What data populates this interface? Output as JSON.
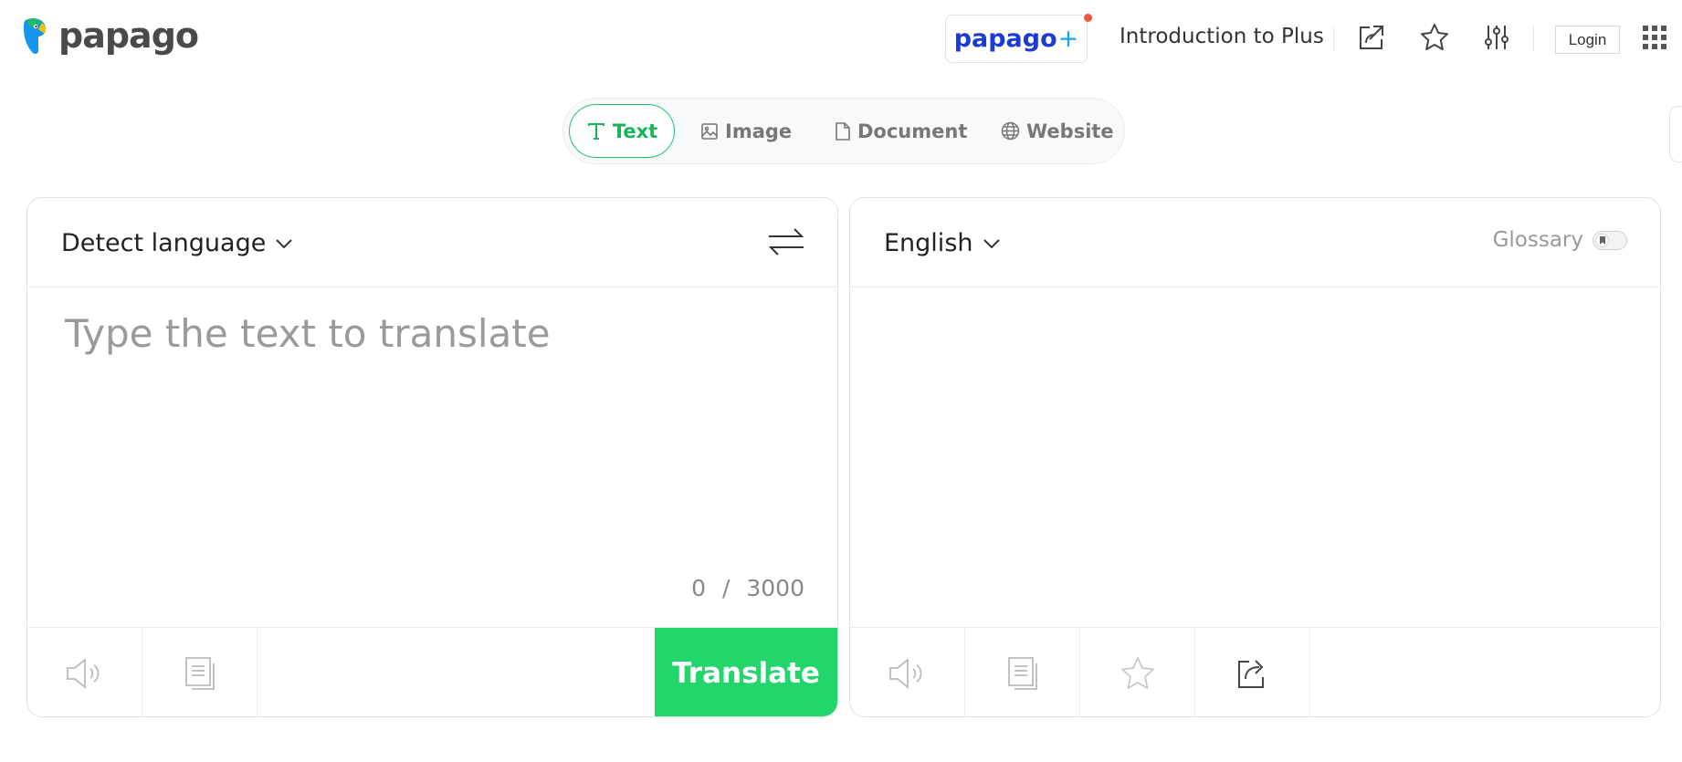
{
  "header": {
    "logo_text": "papago",
    "plus_button": {
      "label": "papago",
      "plus_symbol": "+"
    },
    "intro_link": "Introduction to Plus",
    "icons": [
      "external-link-icon",
      "star-icon",
      "settings-sliders-icon",
      "apps-grid-icon"
    ],
    "login_label": "Login"
  },
  "tabs": [
    {
      "label": "Text",
      "icon": "text-icon",
      "active": true
    },
    {
      "label": "Image",
      "icon": "image-icon",
      "active": false
    },
    {
      "label": "Document",
      "icon": "document-icon",
      "active": false
    },
    {
      "label": "Website",
      "icon": "globe-icon",
      "active": false
    }
  ],
  "source": {
    "language": "Detect language",
    "placeholder": "Type the text to translate",
    "value": "",
    "char_count": "0",
    "char_separator": "/",
    "char_limit": "3000",
    "translate_label": "Translate"
  },
  "target": {
    "language": "English",
    "glossary_label": "Glossary",
    "glossary_enabled": false
  },
  "colors": {
    "accent_green": "#22d66c",
    "active_tab_green": "#18b45a",
    "papago_blue": "#1b3bd6",
    "notification_red": "#f0553b"
  }
}
